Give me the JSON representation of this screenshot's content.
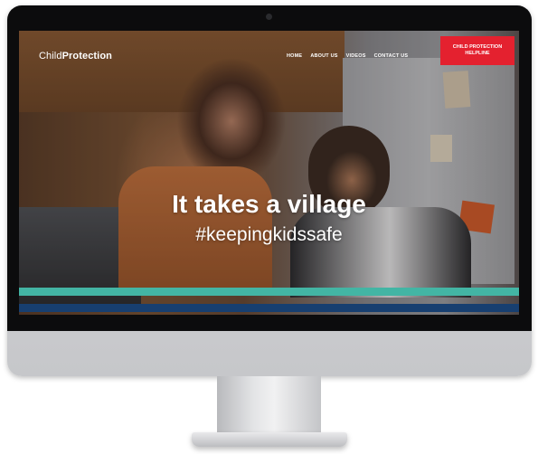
{
  "logo": {
    "part1": "Child",
    "part2": "Protection"
  },
  "nav": {
    "items": [
      {
        "label": "HOME"
      },
      {
        "label": "ABOUT US"
      },
      {
        "label": "VIDEOS"
      },
      {
        "label": "CONTACT US"
      }
    ],
    "helpline_label": "CHILD PROTECTION HELPLINE"
  },
  "hero": {
    "title": "It takes a village",
    "subtitle": "#keepingkidssafe"
  },
  "colors": {
    "accent_red": "#e4212f",
    "stripe_teal": "#43b5a4",
    "stripe_navy": "#173f70"
  }
}
